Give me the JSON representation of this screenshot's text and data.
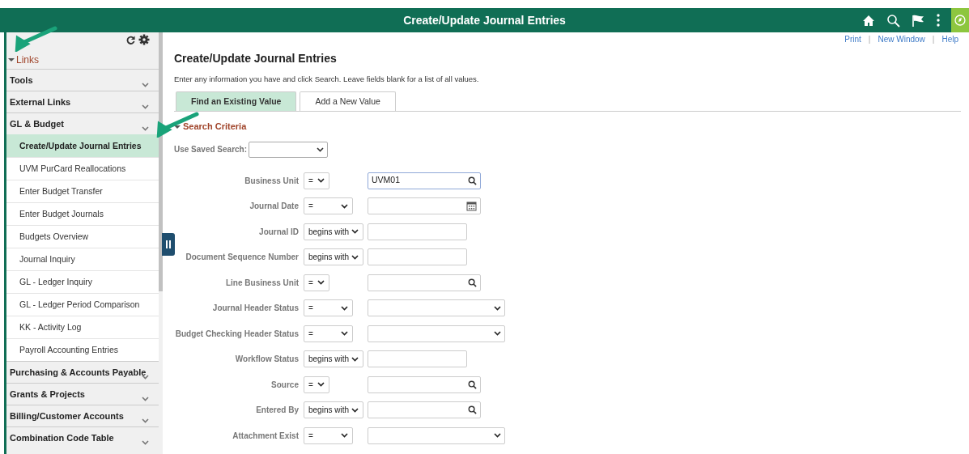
{
  "header": {
    "title": "Create/Update Journal Entries"
  },
  "top_links": [
    "Print",
    "New Window",
    "Help"
  ],
  "link_separator": "|",
  "sidebar": {
    "title": "Links",
    "expanded": true,
    "groups": [
      {
        "label": "Tools"
      },
      {
        "label": "External Links"
      },
      {
        "label": "GL & Budget",
        "children": [
          {
            "label": "Create/Update Journal Entries",
            "selected": true
          },
          {
            "label": "UVM PurCard Reallocations",
            "selected": false
          },
          {
            "label": "Enter Budget Transfer",
            "selected": false
          },
          {
            "label": "Enter Budget Journals",
            "selected": false
          },
          {
            "label": "Budgets Overview",
            "selected": false
          },
          {
            "label": "Journal Inquiry",
            "selected": false
          },
          {
            "label": "GL - Ledger Inquiry",
            "selected": false
          },
          {
            "label": "GL - Ledger Period Comparison",
            "selected": false
          },
          {
            "label": "KK - Activity Log",
            "selected": false
          },
          {
            "label": "Payroll Accounting Entries",
            "selected": false
          }
        ]
      },
      {
        "label": "Purchasing & Accounts Payable"
      },
      {
        "label": "Grants & Projects"
      },
      {
        "label": "Billing/Customer Accounts"
      },
      {
        "label": "Combination Code Table"
      }
    ]
  },
  "page": {
    "title": "Create/Update Journal Entries",
    "instructions": "Enter any information you have and click Search. Leave fields blank for a list of all values.",
    "tabs": [
      {
        "label": "Find an Existing Value",
        "selected": true
      },
      {
        "label": "Add a New Value",
        "selected": false
      }
    ],
    "section": {
      "title": "Search Criteria",
      "expanded": true
    },
    "saved_search_label": "Use Saved Search:",
    "fields": [
      {
        "label": "Business Unit",
        "operator": "=",
        "kind": "lookup",
        "value": "UVM01"
      },
      {
        "label": "Journal Date",
        "operator": "=",
        "kind": "date"
      },
      {
        "label": "Journal ID",
        "operator": "begins with",
        "kind": "text"
      },
      {
        "label": "Document Sequence Number",
        "operator": "begins with",
        "kind": "text"
      },
      {
        "label": "Line Business Unit",
        "operator": "=",
        "kind": "lookup"
      },
      {
        "label": "Journal Header Status",
        "operator": "=",
        "kind": "dropdown"
      },
      {
        "label": "Budget Checking Header Status",
        "operator": "=",
        "kind": "dropdown"
      },
      {
        "label": "Workflow Status",
        "operator": "begins with",
        "kind": "text"
      },
      {
        "label": "Source",
        "operator": "=",
        "kind": "lookup"
      },
      {
        "label": "Entered By",
        "operator": "begins with",
        "kind": "lookup"
      },
      {
        "label": "Attachment Exist",
        "operator": "=",
        "kind": "dropdown"
      }
    ]
  }
}
